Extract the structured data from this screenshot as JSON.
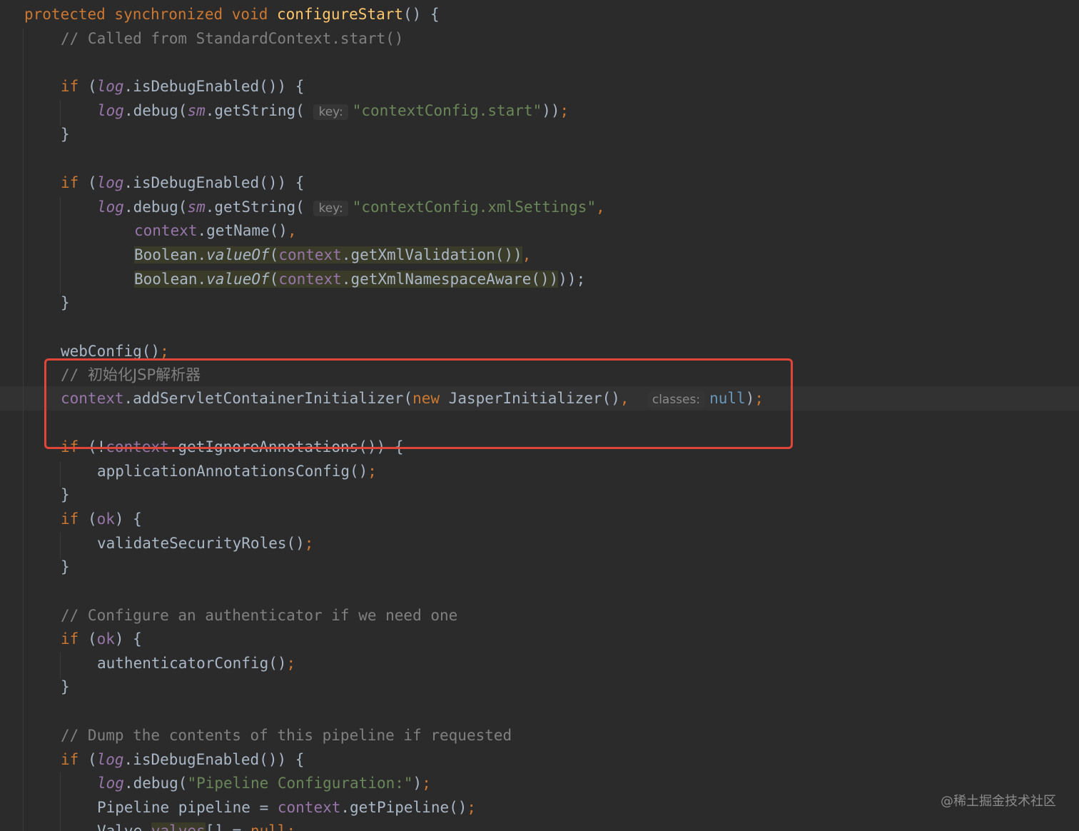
{
  "editor": {
    "theme_colors": {
      "background": "#2b2b2b",
      "keyword": "#cc7832",
      "field": "#9876aa",
      "string": "#6a8759",
      "comment": "#808080",
      "method_decl": "#ffc66d",
      "text": "#a9b7c6",
      "annotation_box": "#e0453a"
    },
    "code": {
      "l01": {
        "a": "protected synchronized void ",
        "b": "configureStart",
        "c": "() {"
      },
      "l02": "// Called from StandardContext.start()",
      "l04": {
        "kw": "if",
        "a": " (",
        "log": "log",
        "b": ".isDebugEnabled()) {"
      },
      "l05": {
        "log": "log",
        "a": ".debug(",
        "sm": "sm",
        "b": ".getString(",
        "hint": "key:",
        "str": "\"contextConfig.start\"",
        "c": "))",
        "semi": ";"
      },
      "l06": "}",
      "l08": {
        "kw": "if",
        "a": " (",
        "log": "log",
        "b": ".isDebugEnabled()) {"
      },
      "l09": {
        "log": "log",
        "a": ".debug(",
        "sm": "sm",
        "b": ".getString(",
        "hint": "key:",
        "str": "\"contextConfig.xmlSettings\"",
        "comma": ","
      },
      "l10": {
        "ctx": "context",
        "a": ".getName()",
        "comma": ","
      },
      "l11": {
        "a": "Boolean.",
        "vo": "valueOf",
        "b": "(",
        "ctx": "context",
        "c": ".getXmlValidation())",
        "comma": ","
      },
      "l12": {
        "a": "Boolean.",
        "vo": "valueOf",
        "b": "(",
        "ctx": "context",
        "c": ".getXmlNamespaceAware())",
        "d": "));",
        "semi": ""
      },
      "l13": "}",
      "l15": {
        "a": "webConfig()",
        "semi": ";"
      },
      "l16": {
        "a": "// ",
        "b": "初始化JSP解析器"
      },
      "l17": {
        "ctx": "context",
        "a": ".addServletContainerInitializer(",
        "kw": "new",
        "b": " JasperInitializer()",
        "comma": ",",
        "hint": "classes:",
        "nul": "null",
        "c": ")",
        "semi": ";"
      },
      "l19": {
        "kw": "if",
        "a": " (!",
        "ctx": "context",
        "b": ".getIgnoreAnnotations()) {"
      },
      "l20": {
        "a": "applicationAnnotationsConfig()",
        "semi": ";"
      },
      "l21": "}",
      "l22": {
        "kw": "if",
        "a": " (",
        "ok": "ok",
        "b": ") {"
      },
      "l23": {
        "a": "validateSecurityRoles()",
        "semi": ";"
      },
      "l24": "}",
      "l26": "// Configure an authenticator if we need one",
      "l27": {
        "kw": "if",
        "a": " (",
        "ok": "ok",
        "b": ") {"
      },
      "l28": {
        "a": "authenticatorConfig()",
        "semi": ";"
      },
      "l29": "}",
      "l31": "// Dump the contents of this pipeline if requested",
      "l32": {
        "kw": "if",
        "a": " (",
        "log": "log",
        "b": ".isDebugEnabled()) {"
      },
      "l33": {
        "log": "log",
        "a": ".debug(",
        "str": "\"Pipeline Configuration:\"",
        "b": ")",
        "semi": ";"
      },
      "l34": {
        "a": "Pipeline pipeline = ",
        "ctx": "context",
        "b": ".getPipeline()",
        "semi": ";"
      },
      "l35": {
        "a": "Valve ",
        "v": "valves",
        "b": "[] = ",
        "nul": "null",
        "semi": ";"
      }
    }
  },
  "watermark": "@稀土掘金技术社区"
}
